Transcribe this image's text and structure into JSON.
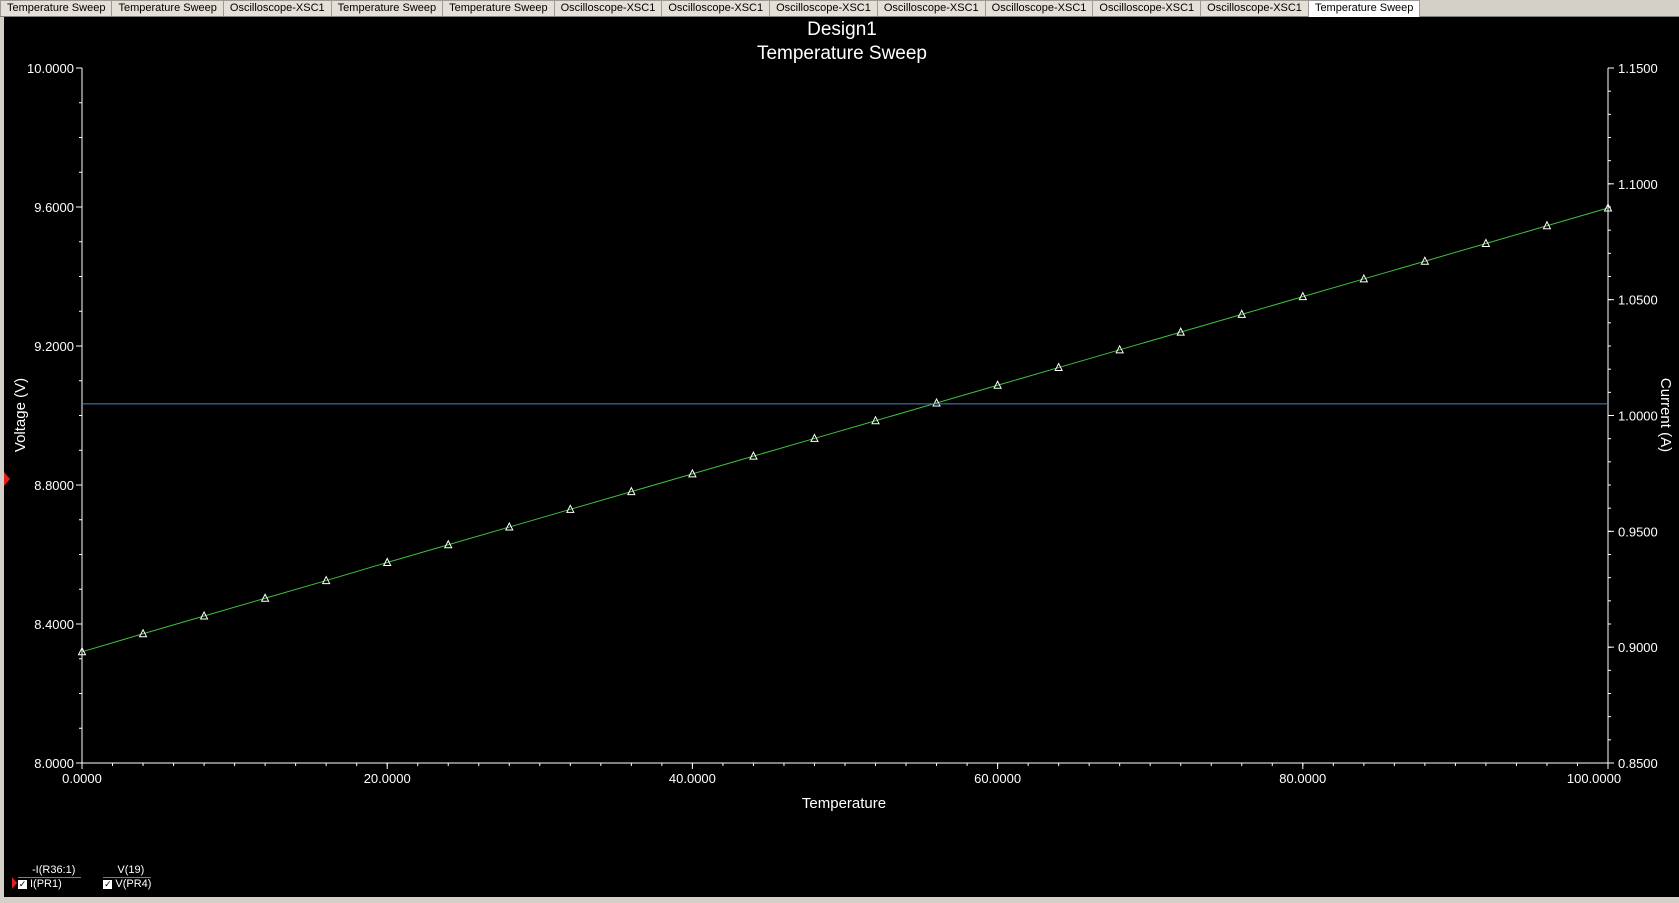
{
  "tabs": [
    {
      "label": "Temperature Sweep",
      "active": false
    },
    {
      "label": "Temperature Sweep",
      "active": false
    },
    {
      "label": "Oscilloscope-XSC1",
      "active": false
    },
    {
      "label": "Temperature Sweep",
      "active": false
    },
    {
      "label": "Temperature Sweep",
      "active": false
    },
    {
      "label": "Oscilloscope-XSC1",
      "active": false
    },
    {
      "label": "Oscilloscope-XSC1",
      "active": false
    },
    {
      "label": "Oscilloscope-XSC1",
      "active": false
    },
    {
      "label": "Oscilloscope-XSC1",
      "active": false
    },
    {
      "label": "Oscilloscope-XSC1",
      "active": false
    },
    {
      "label": "Oscilloscope-XSC1",
      "active": false
    },
    {
      "label": "Oscilloscope-XSC1",
      "active": false
    },
    {
      "label": "Temperature Sweep",
      "active": true
    }
  ],
  "legend": [
    {
      "top": "-I(R36:1)",
      "bottom": "I(PR1)",
      "checked": true,
      "color": "#4a86c8"
    },
    {
      "top": "V(19)",
      "bottom": "V(PR4)",
      "checked": true,
      "color": "#4a86c8"
    }
  ],
  "colors": {
    "background": "#000000",
    "voltage_series": "#3fbf3f",
    "current_series": "#4a86c8",
    "axis": "#ffffff"
  },
  "chart_data": {
    "type": "line",
    "title": "Design1",
    "subtitle": "Temperature Sweep",
    "xlabel": "Temperature",
    "ylabel": "Voltage (V)",
    "y2label": "Current (A)",
    "xlim": [
      0,
      100
    ],
    "ylim": [
      8.0,
      10.0
    ],
    "y2lim": [
      0.85,
      1.15
    ],
    "x_ticks": [
      "0.0000",
      "20.0000",
      "40.0000",
      "60.0000",
      "80.0000",
      "100.0000"
    ],
    "y_ticks": [
      "8.0000",
      "8.4000",
      "8.8000",
      "9.2000",
      "9.6000",
      "10.0000"
    ],
    "y2_ticks": [
      "0.8500",
      "0.9000",
      "0.9500",
      "1.0000",
      "1.0500",
      "1.1000",
      "1.1500"
    ],
    "grid": false,
    "series": [
      {
        "name": "V(19)",
        "axis": "left",
        "color": "#3fbf3f",
        "marker": "triangle",
        "x": [
          0,
          4,
          8,
          12,
          16,
          20,
          24,
          28,
          32,
          36,
          40,
          44,
          48,
          52,
          56,
          60,
          64,
          68,
          72,
          76,
          80,
          84,
          88,
          92,
          96,
          100
        ],
        "values": [
          8.32,
          8.372,
          8.423,
          8.474,
          8.525,
          8.577,
          8.628,
          8.679,
          8.73,
          8.781,
          8.832,
          8.883,
          8.934,
          8.985,
          9.036,
          9.087,
          9.138,
          9.189,
          9.24,
          9.291,
          9.342,
          9.393,
          9.444,
          9.495,
          9.546,
          9.597
        ]
      },
      {
        "name": "-I(R36:1)",
        "axis": "right",
        "color": "#4a86c8",
        "marker": "none",
        "x": [
          0,
          100
        ],
        "values": [
          1.005,
          1.005
        ]
      }
    ]
  }
}
